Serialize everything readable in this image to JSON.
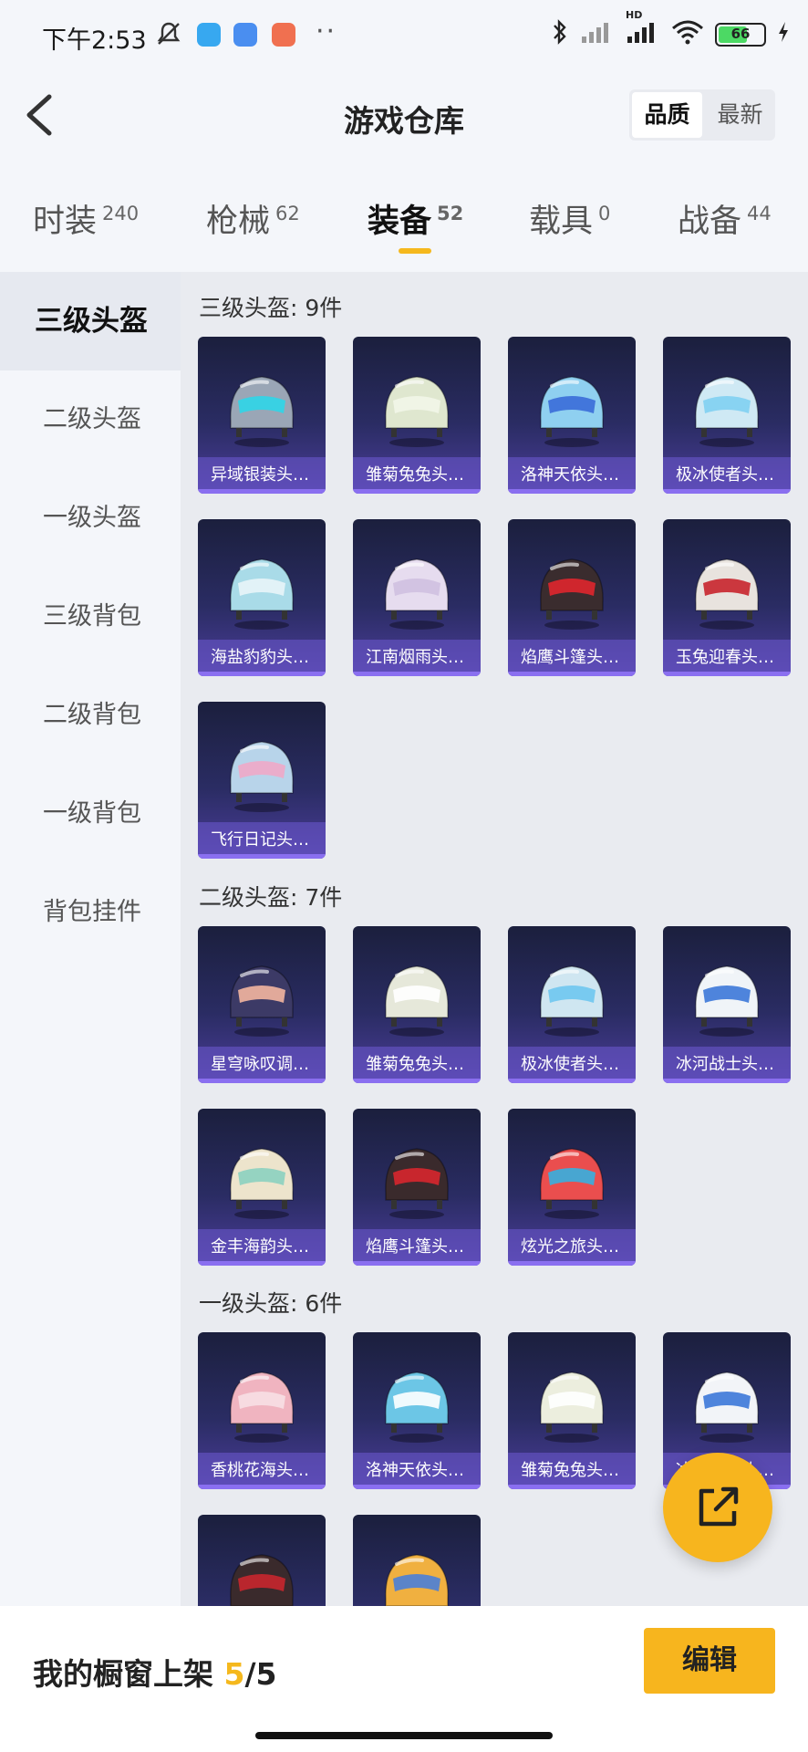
{
  "status_bar": {
    "time": "下午2:53",
    "battery": "66",
    "battery_level": 0.66,
    "network_label": "HD"
  },
  "header": {
    "title": "游戏仓库",
    "sort_options": [
      "品质",
      "最新"
    ],
    "sort_selected": "品质"
  },
  "tabs": [
    {
      "label": "时装",
      "count": "240"
    },
    {
      "label": "枪械",
      "count": "62"
    },
    {
      "label": "装备",
      "count": "52",
      "active": true
    },
    {
      "label": "载具",
      "count": "0"
    },
    {
      "label": "战备",
      "count": "44"
    }
  ],
  "sidebar": {
    "items": [
      "三级头盔",
      "二级头盔",
      "一级头盔",
      "三级背包",
      "二级背包",
      "一级背包",
      "背包挂件"
    ],
    "active": "三级头盔"
  },
  "sections": [
    {
      "title": "三级头盔: 9件",
      "items": [
        {
          "name": "异域银装头…",
          "color": "#9aa6b6",
          "accent": "#2fd6e8"
        },
        {
          "name": "雏菊兔兔头…",
          "color": "#dfe7cf",
          "accent": "#f2f6e8"
        },
        {
          "name": "洛神天依头…",
          "color": "#8fd0f0",
          "accent": "#3a6cd8"
        },
        {
          "name": "极冰使者头…",
          "color": "#cfe9f4",
          "accent": "#7fd0f2"
        },
        {
          "name": "海盐豹豹头…",
          "color": "#a9dbe8",
          "accent": "#e8f4f8"
        },
        {
          "name": "江南烟雨头…",
          "color": "#e6dcef",
          "accent": "#cfc0e0"
        },
        {
          "name": "焰鹰斗篷头…",
          "color": "#3a2c2e",
          "accent": "#e0262e"
        },
        {
          "name": "玉兔迎春头…",
          "color": "#e8e3de",
          "accent": "#c8232c"
        },
        {
          "name": "飞行日记头…",
          "color": "#b8d4ea",
          "accent": "#f0a8c8"
        }
      ]
    },
    {
      "title": "二级头盔: 7件",
      "items": [
        {
          "name": "星穹咏叹调…",
          "color": "#3c3a66",
          "accent": "#f3b6a0"
        },
        {
          "name": "雏菊兔兔头…",
          "color": "#e6e8da",
          "accent": "#ffffff"
        },
        {
          "name": "极冰使者头…",
          "color": "#cfe6f1",
          "accent": "#6ec6f0"
        },
        {
          "name": "冰河战士头…",
          "color": "#f0f4f8",
          "accent": "#3c78d8"
        },
        {
          "name": "金丰海韵头…",
          "color": "#ede4cc",
          "accent": "#8bd0c0"
        },
        {
          "name": "焰鹰斗篷头…",
          "color": "#3a2a2c",
          "accent": "#d8262e"
        },
        {
          "name": "炫光之旅头…",
          "color": "#ea4e4e",
          "accent": "#36b0e0"
        }
      ]
    },
    {
      "title": "一级头盔: 6件",
      "items": [
        {
          "name": "香桃花海头…",
          "color": "#f0b4c0",
          "accent": "#f7dfe4"
        },
        {
          "name": "洛神天依头…",
          "color": "#6cc6e6",
          "accent": "#ffffff"
        },
        {
          "name": "雏菊兔兔头…",
          "color": "#eceede",
          "accent": "#ffffff"
        },
        {
          "name": "冰河战士头…",
          "color": "#f2f4f8",
          "accent": "#3c78d8"
        },
        {
          "name": "",
          "color": "#3a2a2c",
          "accent": "#c8262e"
        },
        {
          "name": "",
          "color": "#f0b040",
          "accent": "#4a80d8"
        }
      ]
    }
  ],
  "bottom": {
    "showcase_label": "我的橱窗上架",
    "showcase_current": "5",
    "showcase_total": "/5",
    "edit_label": "编辑"
  }
}
